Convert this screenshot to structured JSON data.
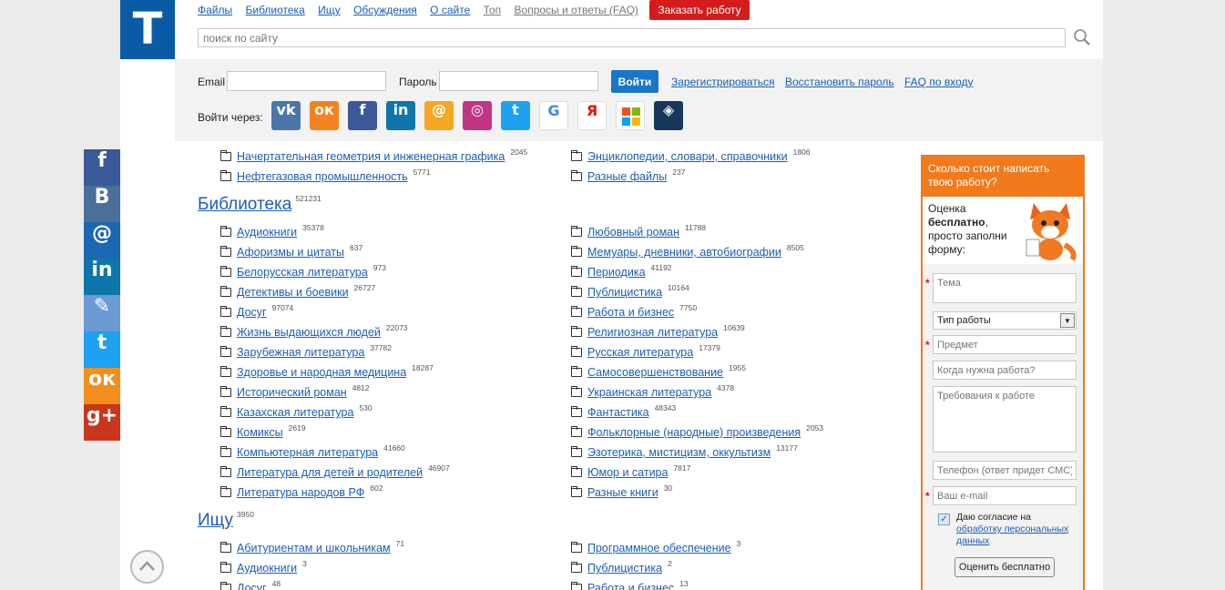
{
  "logo": "T",
  "nav": [
    "Файлы",
    "Библиотека",
    "Ищу",
    "Обсуждения",
    "О сайте",
    "Топ",
    "Вопросы и ответы (FAQ)"
  ],
  "order_button": "Заказать работу",
  "search_placeholder": "поиск по сайту",
  "login": {
    "email_label": "Email",
    "password_label": "Пароль",
    "submit": "Войти",
    "register": "Зарегистрироваться",
    "restore": "Восстановить пароль",
    "faq": "FAQ по входу",
    "via_label": "Войти через:"
  },
  "login_socials": [
    {
      "name": "vk",
      "glyph": "vk",
      "color": "#4a76a8"
    },
    {
      "name": "odnoklassniki",
      "glyph": "ок",
      "color": "#f4821f"
    },
    {
      "name": "facebook",
      "glyph": "f",
      "color": "#3b5998"
    },
    {
      "name": "linkedin",
      "glyph": "in",
      "color": "#0e76a8"
    },
    {
      "name": "mailru",
      "glyph": "@",
      "color": "#f5a623"
    },
    {
      "name": "instagram",
      "glyph": "◎",
      "color": "#c13584"
    },
    {
      "name": "twitter",
      "glyph": "t",
      "color": "#1da1f2"
    },
    {
      "name": "google",
      "glyph": "G",
      "color": "#ffffff"
    },
    {
      "name": "yandex",
      "glyph": "Я",
      "color": "#ffffff"
    },
    {
      "name": "microsoft",
      "glyph": "",
      "color": "#ffffff"
    },
    {
      "name": "other",
      "glyph": "◈",
      "color": "#16365a"
    }
  ],
  "top_items": {
    "left": [
      {
        "label": "Начертательная геометрия и инженерная графика",
        "count": "2045"
      },
      {
        "label": "Нефтегазовая промышленность",
        "count": "5771"
      }
    ],
    "right": [
      {
        "label": "Энциклопедии, словари, справочники",
        "count": "1806"
      },
      {
        "label": "Разные файлы",
        "count": "237"
      }
    ]
  },
  "library": {
    "title": "Библиотека",
    "count": "521231",
    "left": [
      {
        "label": "Аудиокниги",
        "count": "35378"
      },
      {
        "label": "Афоризмы и цитаты",
        "count": "637"
      },
      {
        "label": "Белорусская литература",
        "count": "973"
      },
      {
        "label": "Детективы и боевики",
        "count": "26727"
      },
      {
        "label": "Досуг",
        "count": "97074"
      },
      {
        "label": "Жизнь выдающихся людей",
        "count": "22073"
      },
      {
        "label": "Зарубежная литература",
        "count": "37782"
      },
      {
        "label": "Здоровье и народная медицина",
        "count": "18287"
      },
      {
        "label": "Исторический роман",
        "count": "4812"
      },
      {
        "label": "Казахская литература",
        "count": "530"
      },
      {
        "label": "Комиксы",
        "count": "2619"
      },
      {
        "label": "Компьютерная литература",
        "count": "41660"
      },
      {
        "label": "Литература для детей и родителей",
        "count": "46907"
      },
      {
        "label": "Литература народов РФ",
        "count": "602"
      }
    ],
    "right": [
      {
        "label": "Любовный роман",
        "count": "11788"
      },
      {
        "label": "Мемуары, дневники, автобиографии",
        "count": "8505"
      },
      {
        "label": "Периодика",
        "count": "41192"
      },
      {
        "label": "Публицистика",
        "count": "10164"
      },
      {
        "label": "Работа и бизнес",
        "count": "7750"
      },
      {
        "label": "Религиозная литература",
        "count": "10639"
      },
      {
        "label": "Русская литература",
        "count": "17379"
      },
      {
        "label": "Самосовершенствование",
        "count": "1955"
      },
      {
        "label": "Украинская литература",
        "count": "4378"
      },
      {
        "label": "Фантастика",
        "count": "48343"
      },
      {
        "label": "Фольклорные (народные) произведения",
        "count": "2053"
      },
      {
        "label": "Эзотерика, мистицизм, оккультизм",
        "count": "13177"
      },
      {
        "label": "Юмор и сатира",
        "count": "7817"
      },
      {
        "label": "Разные книги",
        "count": "30"
      }
    ]
  },
  "wanted": {
    "title": "Ищу",
    "count": "3950",
    "left": [
      {
        "label": "Абитуриентам и школьникам",
        "count": "71"
      },
      {
        "label": "Аудиокниги",
        "count": "3"
      },
      {
        "label": "Досуг",
        "count": "48"
      }
    ],
    "right": [
      {
        "label": "Программное обеспечение",
        "count": "3"
      },
      {
        "label": "Публицистика",
        "count": "2"
      },
      {
        "label": "Работа и бизнес",
        "count": "13"
      }
    ]
  },
  "form": {
    "header": "Сколько стоит написать твою работу?",
    "intro_1": "Оценка",
    "intro_bold": "бесплатно",
    "intro_2": ",",
    "intro_3": "просто заполни форму:",
    "topic": "Тема",
    "work_type": "Тип работы",
    "subject": "Предмет",
    "deadline": "Когда нужна работа?",
    "requirements": "Требования к работе",
    "phone": "Телефон (ответ придет СМС)",
    "email": "Ваш e-mail",
    "consent_1": "Даю согласие на",
    "consent_link": "обработку персональных данных",
    "submit": "Оценить бесплатно"
  },
  "share_bar": [
    {
      "name": "facebook",
      "glyph": "f",
      "color": "#3b5998"
    },
    {
      "name": "vk",
      "glyph": "B",
      "color": "#4a6f99"
    },
    {
      "name": "mailru",
      "glyph": "@",
      "color": "#1c67b4"
    },
    {
      "name": "linkedin",
      "glyph": "in",
      "color": "#0e76a8"
    },
    {
      "name": "livejournal",
      "glyph": "✎",
      "color": "#6c9ad2"
    },
    {
      "name": "twitter",
      "glyph": "t",
      "color": "#1da1f2"
    },
    {
      "name": "odnoklassniki",
      "glyph": "ок",
      "color": "#f28e1c"
    },
    {
      "name": "googleplus",
      "glyph": "g+",
      "color": "#c9361c"
    }
  ]
}
